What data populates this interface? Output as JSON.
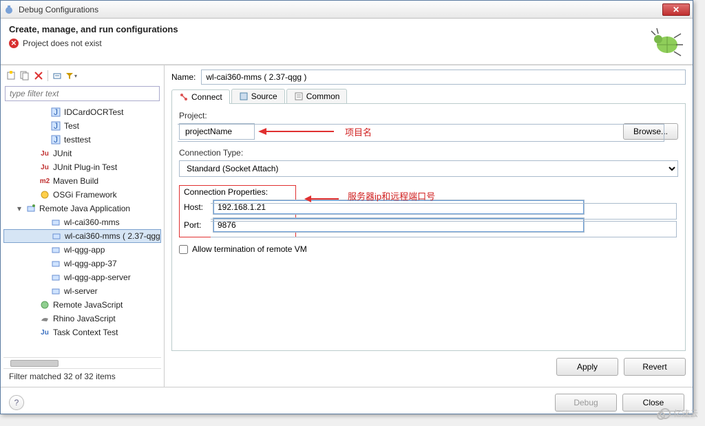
{
  "window": {
    "title": "Debug Configurations"
  },
  "header": {
    "heading": "Create, manage, and run configurations",
    "error": "Project does not exist"
  },
  "toolbar_icons": [
    "new",
    "copy",
    "delete",
    "collapse",
    "expand"
  ],
  "filter_placeholder": "type filter text",
  "tree": [
    {
      "label": "IDCardOCRTest",
      "indent": 3,
      "icon": "j"
    },
    {
      "label": "Test",
      "indent": 3,
      "icon": "j"
    },
    {
      "label": "testtest",
      "indent": 3,
      "icon": "j"
    },
    {
      "label": "JUnit",
      "indent": 2,
      "icon": "ju"
    },
    {
      "label": "JUnit Plug-in Test",
      "indent": 2,
      "icon": "ju"
    },
    {
      "label": "Maven Build",
      "indent": 2,
      "icon": "m2"
    },
    {
      "label": "OSGi Framework",
      "indent": 2,
      "icon": "osgi"
    },
    {
      "label": "Remote Java Application",
      "indent": 1,
      "icon": "rja",
      "expanded": true
    },
    {
      "label": "wl-cai360-mms",
      "indent": 3,
      "icon": "rj"
    },
    {
      "label": "wl-cai360-mms ( 2.37-qgg",
      "indent": 3,
      "icon": "rj",
      "selected": true
    },
    {
      "label": "wl-qgg-app",
      "indent": 3,
      "icon": "rj"
    },
    {
      "label": "wl-qgg-app-37",
      "indent": 3,
      "icon": "rj"
    },
    {
      "label": "wl-qgg-app-server",
      "indent": 3,
      "icon": "rj"
    },
    {
      "label": "wl-server",
      "indent": 3,
      "icon": "rj"
    },
    {
      "label": "Remote JavaScript",
      "indent": 2,
      "icon": "js"
    },
    {
      "label": "Rhino JavaScript",
      "indent": 2,
      "icon": "rhino"
    },
    {
      "label": "Task Context Test",
      "indent": 2,
      "icon": "task"
    }
  ],
  "filter_status": "Filter matched 32 of 32 items",
  "right": {
    "name_label": "Name:",
    "name_value": "wl-cai360-mms ( 2.37-qgg )",
    "tabs": {
      "connect": "Connect",
      "source": "Source",
      "common": "Common"
    },
    "project_label": "Project:",
    "project_value": "projectName",
    "browse": "Browse...",
    "annotation_project": "项目名",
    "conn_type_label": "Connection Type:",
    "conn_type_value": "Standard (Socket Attach)",
    "conn_props_label": "Connection Properties:",
    "host_label": "Host:",
    "host_value": "192.168.1.21",
    "port_label": "Port:",
    "port_value": "9876",
    "annotation_conn": "服务器ip和远程端口号",
    "allow_term": "Allow termination of remote VM",
    "apply": "Apply",
    "revert": "Revert"
  },
  "bottom": {
    "debug": "Debug",
    "close": "Close"
  },
  "watermark": "亿速云"
}
